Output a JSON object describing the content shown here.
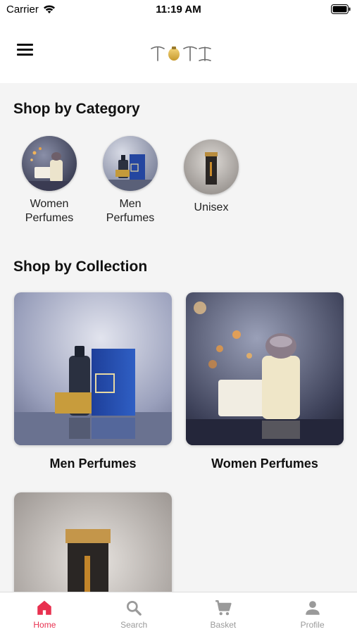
{
  "status_bar": {
    "carrier": "Carrier",
    "time": "11:19 AM"
  },
  "header": {
    "menu_icon": "hamburger-menu-icon",
    "logo_text": "TOTI"
  },
  "category_section": {
    "title": "Shop by Category",
    "items": [
      {
        "label": "Women\nPerfumes"
      },
      {
        "label": "Men\nPerfumes"
      },
      {
        "label": "Unisex"
      }
    ]
  },
  "collection_section": {
    "title": "Shop by Collection",
    "items": [
      {
        "label": "Men Perfumes"
      },
      {
        "label": "Women Perfumes"
      },
      {
        "label": ""
      }
    ]
  },
  "tab_bar": {
    "active_color": "#e8304f",
    "inactive_color": "#9a9a9a",
    "tabs": [
      {
        "label": "Home",
        "icon": "home-icon"
      },
      {
        "label": "Search",
        "icon": "search-icon"
      },
      {
        "label": "Basket",
        "icon": "cart-icon"
      },
      {
        "label": "Profile",
        "icon": "person-icon"
      }
    ]
  }
}
